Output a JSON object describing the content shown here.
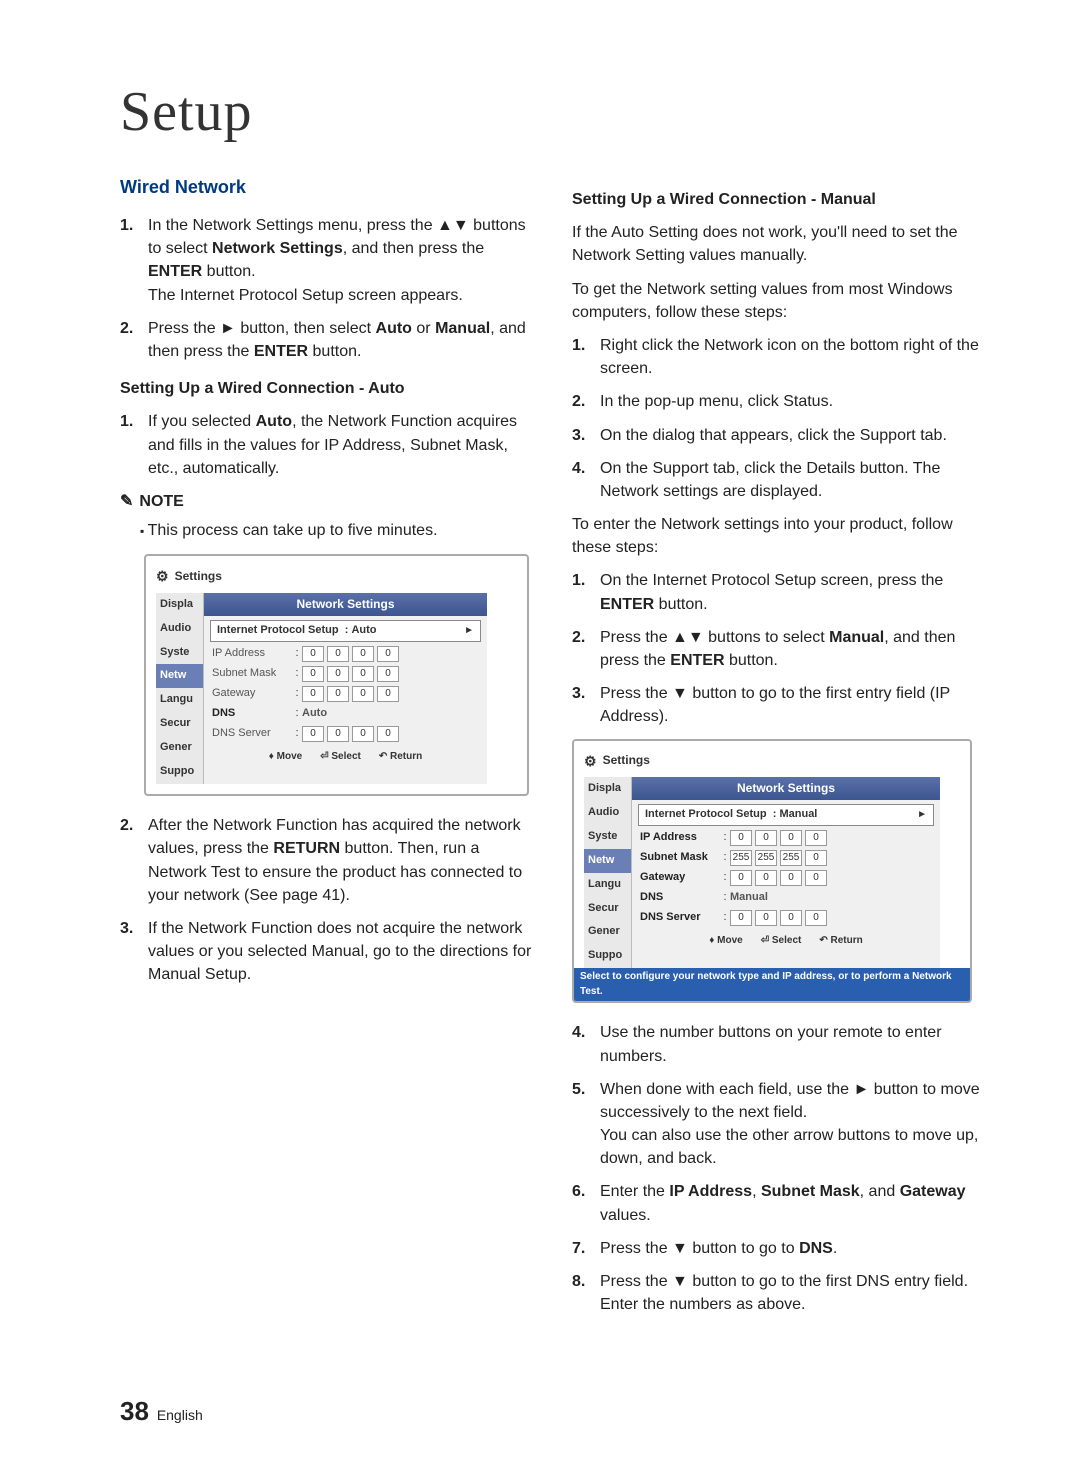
{
  "title": "Setup",
  "left": {
    "section": "Wired Network",
    "steps1": [
      {
        "n": "1.",
        "t": "In the Network Settings menu, press the ▲▼ buttons to select Network Settings, and then press the ENTER button.\nThe Internet Protocol Setup screen appears."
      },
      {
        "n": "2.",
        "t": "Press the ► button, then select Auto or Manual, and then press the ENTER button."
      }
    ],
    "sub1": "Setting Up a Wired Connection - Auto",
    "steps2": [
      {
        "n": "1.",
        "t": "If you selected Auto, the Network Function acquires and fills in the values for IP Address, Subnet Mask, etc., automatically."
      }
    ],
    "note_label": "NOTE",
    "note_items": [
      "This process can take up to five minutes."
    ],
    "steps3": [
      {
        "n": "2.",
        "t": "After the Network Function has acquired the network values, press the RETURN button. Then, run a Network Test to ensure the product has connected to your network (See page 41)."
      },
      {
        "n": "3.",
        "t": "If the Network Function does not acquire the network values or you selected Manual, go to the directions for Manual Setup."
      }
    ]
  },
  "right": {
    "sub1": "Setting Up a Wired Connection - Manual",
    "p1": "If the Auto Setting does not work, you'll need to set the Network Setting values manually.",
    "p2": "To get the Network setting values from most Windows computers, follow these steps:",
    "stepsA": [
      {
        "n": "1.",
        "t": "Right click the Network icon on the bottom right of the screen."
      },
      {
        "n": "2.",
        "t": "In the pop-up menu, click Status."
      },
      {
        "n": "3.",
        "t": "On the dialog that appears, click the Support tab."
      },
      {
        "n": "4.",
        "t": "On the Support tab, click the Details button. The Network settings are displayed."
      }
    ],
    "p3": "To enter the Network settings into your product, follow these steps:",
    "stepsB": [
      {
        "n": "1.",
        "t": "On the Internet Protocol Setup screen, press the ENTER button."
      },
      {
        "n": "2.",
        "t": "Press the ▲▼ buttons to select Manual, and then press the ENTER button."
      },
      {
        "n": "3.",
        "t": "Press the ▼ button to go to the first entry field (IP Address)."
      }
    ],
    "stepsC": [
      {
        "n": "4.",
        "t": "Use the number buttons on your remote to enter numbers."
      },
      {
        "n": "5.",
        "t": "When done with each field, use the ► button to move successively to the next field.\nYou can also use the other arrow buttons to move up, down, and back."
      },
      {
        "n": "6.",
        "t": "Enter the IP Address, Subnet Mask, and Gateway values."
      },
      {
        "n": "7.",
        "t": "Press the ▼ button to go to DNS."
      },
      {
        "n": "8.",
        "t": "Press the ▼ button to go to the first DNS entry field. Enter the numbers as above."
      }
    ]
  },
  "settings": {
    "title": "Settings",
    "panel_title": "Network Settings",
    "sidebar": [
      "Displa",
      "Audio",
      "Syste",
      "Netw",
      "Langu",
      "Secur",
      "Gener",
      "Suppo"
    ],
    "footer": {
      "move": "Move",
      "select": "Select",
      "return": "Return"
    },
    "auto": {
      "proto_label": "Internet Protocol Setup",
      "proto_value": "Auto",
      "ip_label": "IP Address",
      "subnet_label": "Subnet Mask",
      "gateway_label": "Gateway",
      "dns_label": "DNS",
      "dns_value": "Auto",
      "dns_server_label": "DNS Server",
      "ip": [
        "0",
        "0",
        "0",
        "0"
      ],
      "subnet": [
        "0",
        "0",
        "0",
        "0"
      ],
      "gateway": [
        "0",
        "0",
        "0",
        "0"
      ],
      "dns_server": [
        "0",
        "0",
        "0",
        "0"
      ]
    },
    "manual": {
      "proto_label": "Internet Protocol Setup",
      "proto_value": "Manual",
      "ip_label": "IP Address",
      "subnet_label": "Subnet Mask",
      "gateway_label": "Gateway",
      "dns_label": "DNS",
      "dns_value": "Manual",
      "dns_server_label": "DNS Server",
      "ip": [
        "0",
        "0",
        "0",
        "0"
      ],
      "subnet": [
        "255",
        "255",
        "255",
        "0"
      ],
      "gateway": [
        "0",
        "0",
        "0",
        "0"
      ],
      "dns_server": [
        "0",
        "0",
        "0",
        "0"
      ],
      "hint": "Select to configure your network type and IP address, or to perform a Network Test."
    }
  },
  "footer": {
    "page": "38",
    "lang": "English"
  }
}
